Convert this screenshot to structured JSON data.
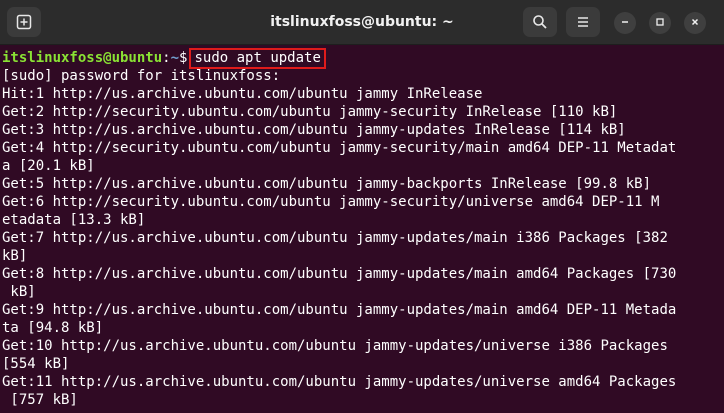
{
  "window": {
    "title": "itslinuxfoss@ubuntu: ~",
    "icons": {
      "new_tab": "new-tab-icon",
      "search": "search-icon",
      "menu": "hamburger-menu-icon",
      "minimize": "minimize-icon",
      "maximize": "maximize-icon",
      "close": "close-icon"
    }
  },
  "colors": {
    "background": "#300a24",
    "prompt_user": "#8ae234",
    "prompt_path": "#729fcf",
    "highlight": "#e01b1b"
  },
  "terminal": {
    "prompt": {
      "user_host": "itslinuxfoss@ubuntu",
      "separator": ":",
      "path": "~",
      "symbol": "$",
      "command": "sudo apt update"
    },
    "lines": [
      "[sudo] password for itslinuxfoss:",
      "Hit:1 http://us.archive.ubuntu.com/ubuntu jammy InRelease",
      "Get:2 http://security.ubuntu.com/ubuntu jammy-security InRelease [110 kB]",
      "Get:3 http://us.archive.ubuntu.com/ubuntu jammy-updates InRelease [114 kB]",
      "Get:4 http://security.ubuntu.com/ubuntu jammy-security/main amd64 DEP-11 Metadat",
      "a [20.1 kB]",
      "Get:5 http://us.archive.ubuntu.com/ubuntu jammy-backports InRelease [99.8 kB]",
      "Get:6 http://security.ubuntu.com/ubuntu jammy-security/universe amd64 DEP-11 M",
      "etadata [13.3 kB]",
      "Get:7 http://us.archive.ubuntu.com/ubuntu jammy-updates/main i386 Packages [382",
      "kB]",
      "Get:8 http://us.archive.ubuntu.com/ubuntu jammy-updates/main amd64 Packages [730",
      " kB]",
      "Get:9 http://us.archive.ubuntu.com/ubuntu jammy-updates/main amd64 DEP-11 Metada",
      "ta [94.8 kB]",
      "Get:10 http://us.archive.ubuntu.com/ubuntu jammy-updates/universe i386 Packages",
      "[554 kB]",
      "Get:11 http://us.archive.ubuntu.com/ubuntu jammy-updates/universe amd64 Packages",
      " [757 kB]"
    ]
  }
}
